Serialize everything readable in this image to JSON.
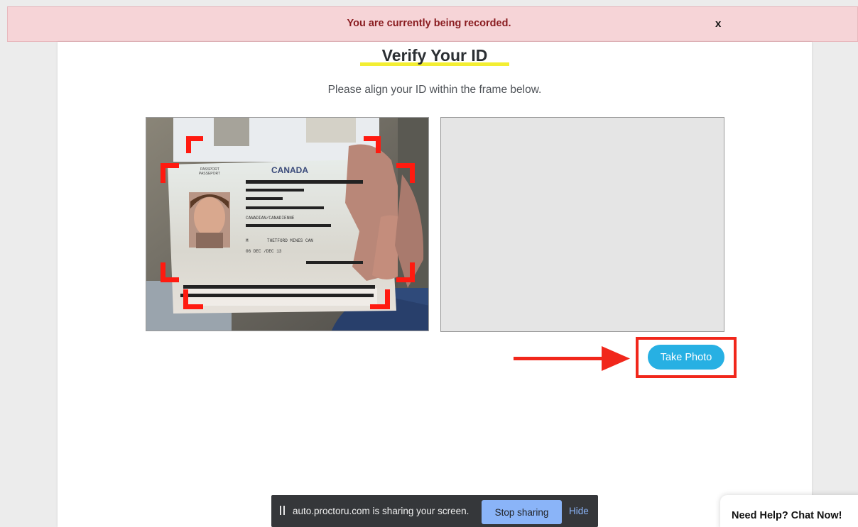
{
  "banner": {
    "message": "You are currently being recorded.",
    "close_label": "x"
  },
  "verification": {
    "title": "Verify Your ID",
    "instructions": "Please align your ID within the frame below.",
    "take_photo_label": "Take Photo"
  },
  "passport": {
    "header_left_1": "PASSPORT",
    "header_left_2": "PASSEPORT",
    "country": "CANADA",
    "nationality": "CANADIAN/CANADIENNE",
    "sex": "M",
    "place_of_birth": "THETFORD MINES CAN",
    "date_issue": "06 DEC /DEC 13"
  },
  "screen_share": {
    "message": "auto.proctoru.com is sharing your screen.",
    "stop_label": "Stop sharing",
    "hide_label": "Hide"
  },
  "chat": {
    "label": "Need Help? Chat Now!"
  },
  "colors": {
    "banner_bg": "#f6d4d7",
    "banner_text": "#8a1d21",
    "accent_button": "#27b0e3",
    "highlight_red": "#f1271b",
    "title_underline": "#f3ee32",
    "stop_button": "#8ab4f8"
  },
  "icons": {
    "pause": "pause-icon",
    "arrow": "arrow-right-icon"
  }
}
